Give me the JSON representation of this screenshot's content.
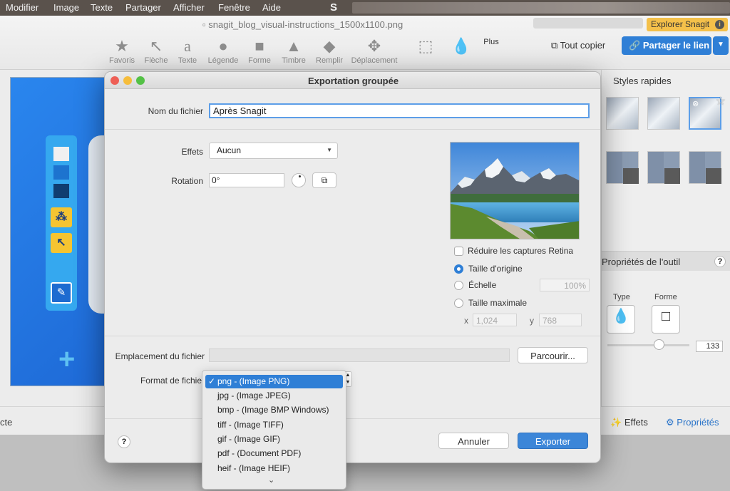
{
  "menubar": {
    "items": [
      "Modifier",
      "Image",
      "Texte",
      "Partager",
      "Afficher",
      "Fenêtre",
      "Aide"
    ],
    "app_glyph": "S"
  },
  "window": {
    "title": "snagit_blog_visual-instructions_1500x1100.png",
    "explore_badge": "Explorer Snagit",
    "copy_all": "Tout copier",
    "share_link": "Partager le lien"
  },
  "toolbar": {
    "tools": [
      "Favoris",
      "Flèche",
      "Texte",
      "Légende",
      "Forme",
      "Timbre",
      "Remplir",
      "Déplacement"
    ],
    "more": "Plus"
  },
  "right_panel": {
    "quick_styles": "Styles rapides",
    "tool_props": "Propriétés de l'outil",
    "type_label": "Type",
    "shape_label": "Forme",
    "slider_value": "133"
  },
  "bottom": {
    "left_text": "cte",
    "effects": "Effets",
    "properties": "Propriétés"
  },
  "dialog": {
    "title": "Exportation groupée",
    "filename_label": "Nom du fichier",
    "filename_value": "Après Snagit",
    "effects_label": "Effets",
    "effects_value": "Aucun",
    "rotation_label": "Rotation",
    "rotation_value": "0°",
    "retina_label": "Réduire les captures Retina",
    "original_size": "Taille d'origine",
    "scale": "Échelle",
    "scale_value": "100%",
    "max_size": "Taille maximale",
    "x_label": "x",
    "x_value": "1,024",
    "y_label": "y",
    "y_value": "768",
    "location_label": "Emplacement du fichier",
    "browse": "Parcourir...",
    "format_label": "Format de fichie",
    "cancel": "Annuler",
    "export": "Exporter",
    "help": "?"
  },
  "format_options": [
    "png - (Image PNG)",
    "jpg - (Image JPEG)",
    "bmp - (Image BMP Windows)",
    "tiff - (Image TIFF)",
    "gif - (Image GIF)",
    "pdf - (Document PDF)",
    "heif - (Image HEIF)"
  ],
  "colors": {
    "accent": "#2f7fd6",
    "canvas_blue": "#1e69d6",
    "badge_yellow": "#f4c04a"
  }
}
